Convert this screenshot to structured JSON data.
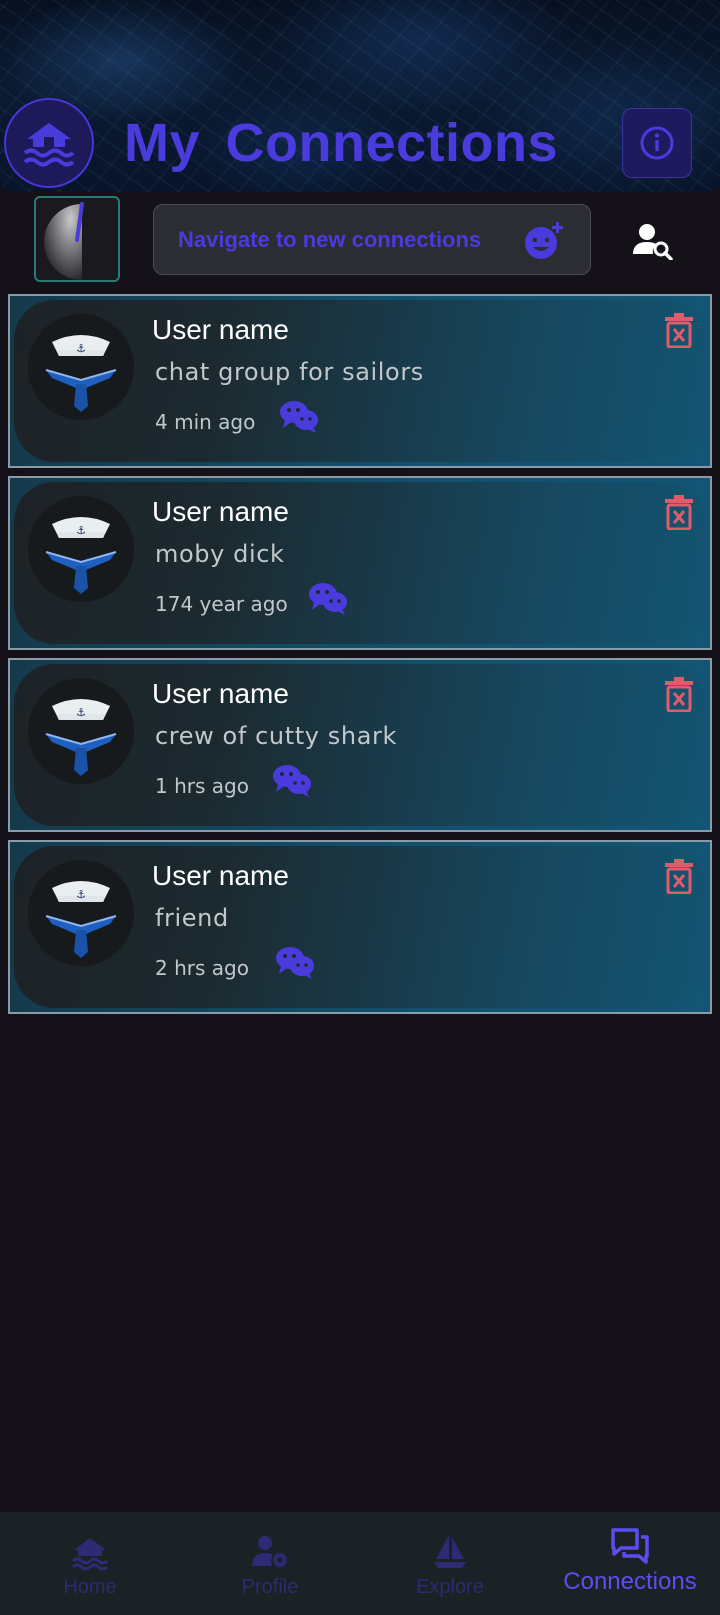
{
  "header": {
    "title": "My Connections"
  },
  "toolbar": {
    "navigate_label": "Navigate to new connections"
  },
  "connections": [
    {
      "name": "User name",
      "message": "chat group for sailors",
      "time": "4 min ago"
    },
    {
      "name": "User name",
      "message": "moby dick",
      "time": "174 year ago"
    },
    {
      "name": "User name",
      "message": "crew of cutty shark",
      "time": "1 hrs ago"
    },
    {
      "name": "User name",
      "message": "friend",
      "time": "2 hrs ago"
    }
  ],
  "bottom_nav": [
    {
      "label": "Home",
      "icon": "home-waves-icon",
      "active": false
    },
    {
      "label": "Profile",
      "icon": "profile-settings-icon",
      "active": false
    },
    {
      "label": "Explore",
      "icon": "sailboat-icon",
      "active": false
    },
    {
      "label": "Connections",
      "icon": "chat-bubbles-icon",
      "active": true
    }
  ],
  "colors": {
    "accent": "#4a3bdd",
    "background": "#141218",
    "delete": "#e05c6a",
    "card": "#125574"
  }
}
